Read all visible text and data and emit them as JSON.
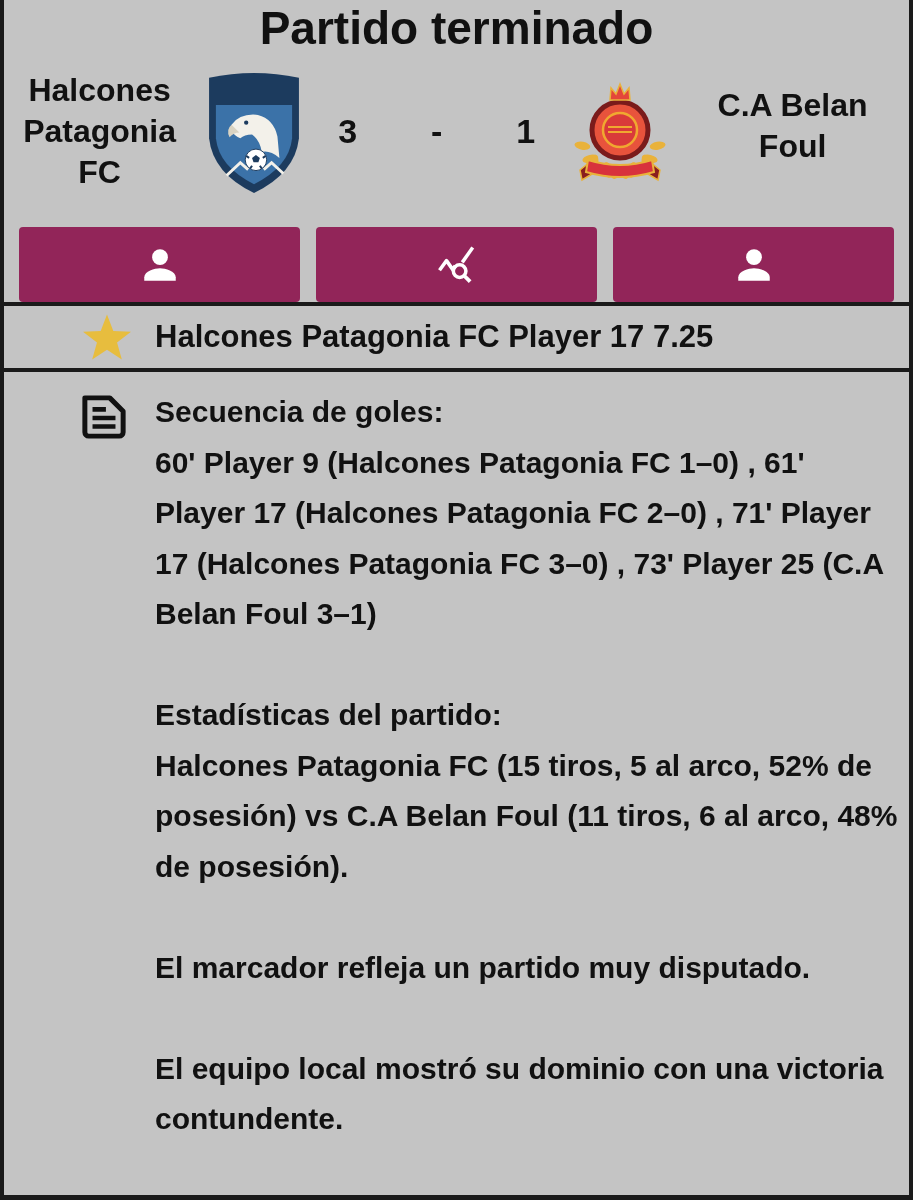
{
  "title": "Partido terminado",
  "match": {
    "home": {
      "name": "Halcones Patagonia FC"
    },
    "score": {
      "home": "3",
      "separator": "-",
      "away": "1"
    },
    "away": {
      "name": "C.A Belan Foul"
    }
  },
  "buttons": [
    {
      "kind": "person"
    },
    {
      "kind": "stats"
    },
    {
      "kind": "person"
    }
  ],
  "best_player": {
    "text": "Halcones Patagonia FC Player 17 7.25"
  },
  "summary": [
    {
      "heading": "Secuencia de goles:",
      "text": "60' Player 9 (Halcones Patagonia FC 1–0) , 61' Player 17 (Halcones Patagonia FC 2–0) , 71' Player 17 (Halcones Patagonia FC 3–0) , 73' Player 25 (C.A Belan Foul 3–1)"
    },
    {
      "heading": "Estadísticas del partido:",
      "text": "Halcones Patagonia FC (15 tiros, 5 al arco, 52% de posesión) vs C.A Belan Foul (11 tiros, 6 al arco, 48% de posesión)."
    },
    {
      "text": "El marcador refleja un partido muy disputado."
    },
    {
      "text": "El equipo local mostró su dominio con una victoria contundente."
    }
  ]
}
